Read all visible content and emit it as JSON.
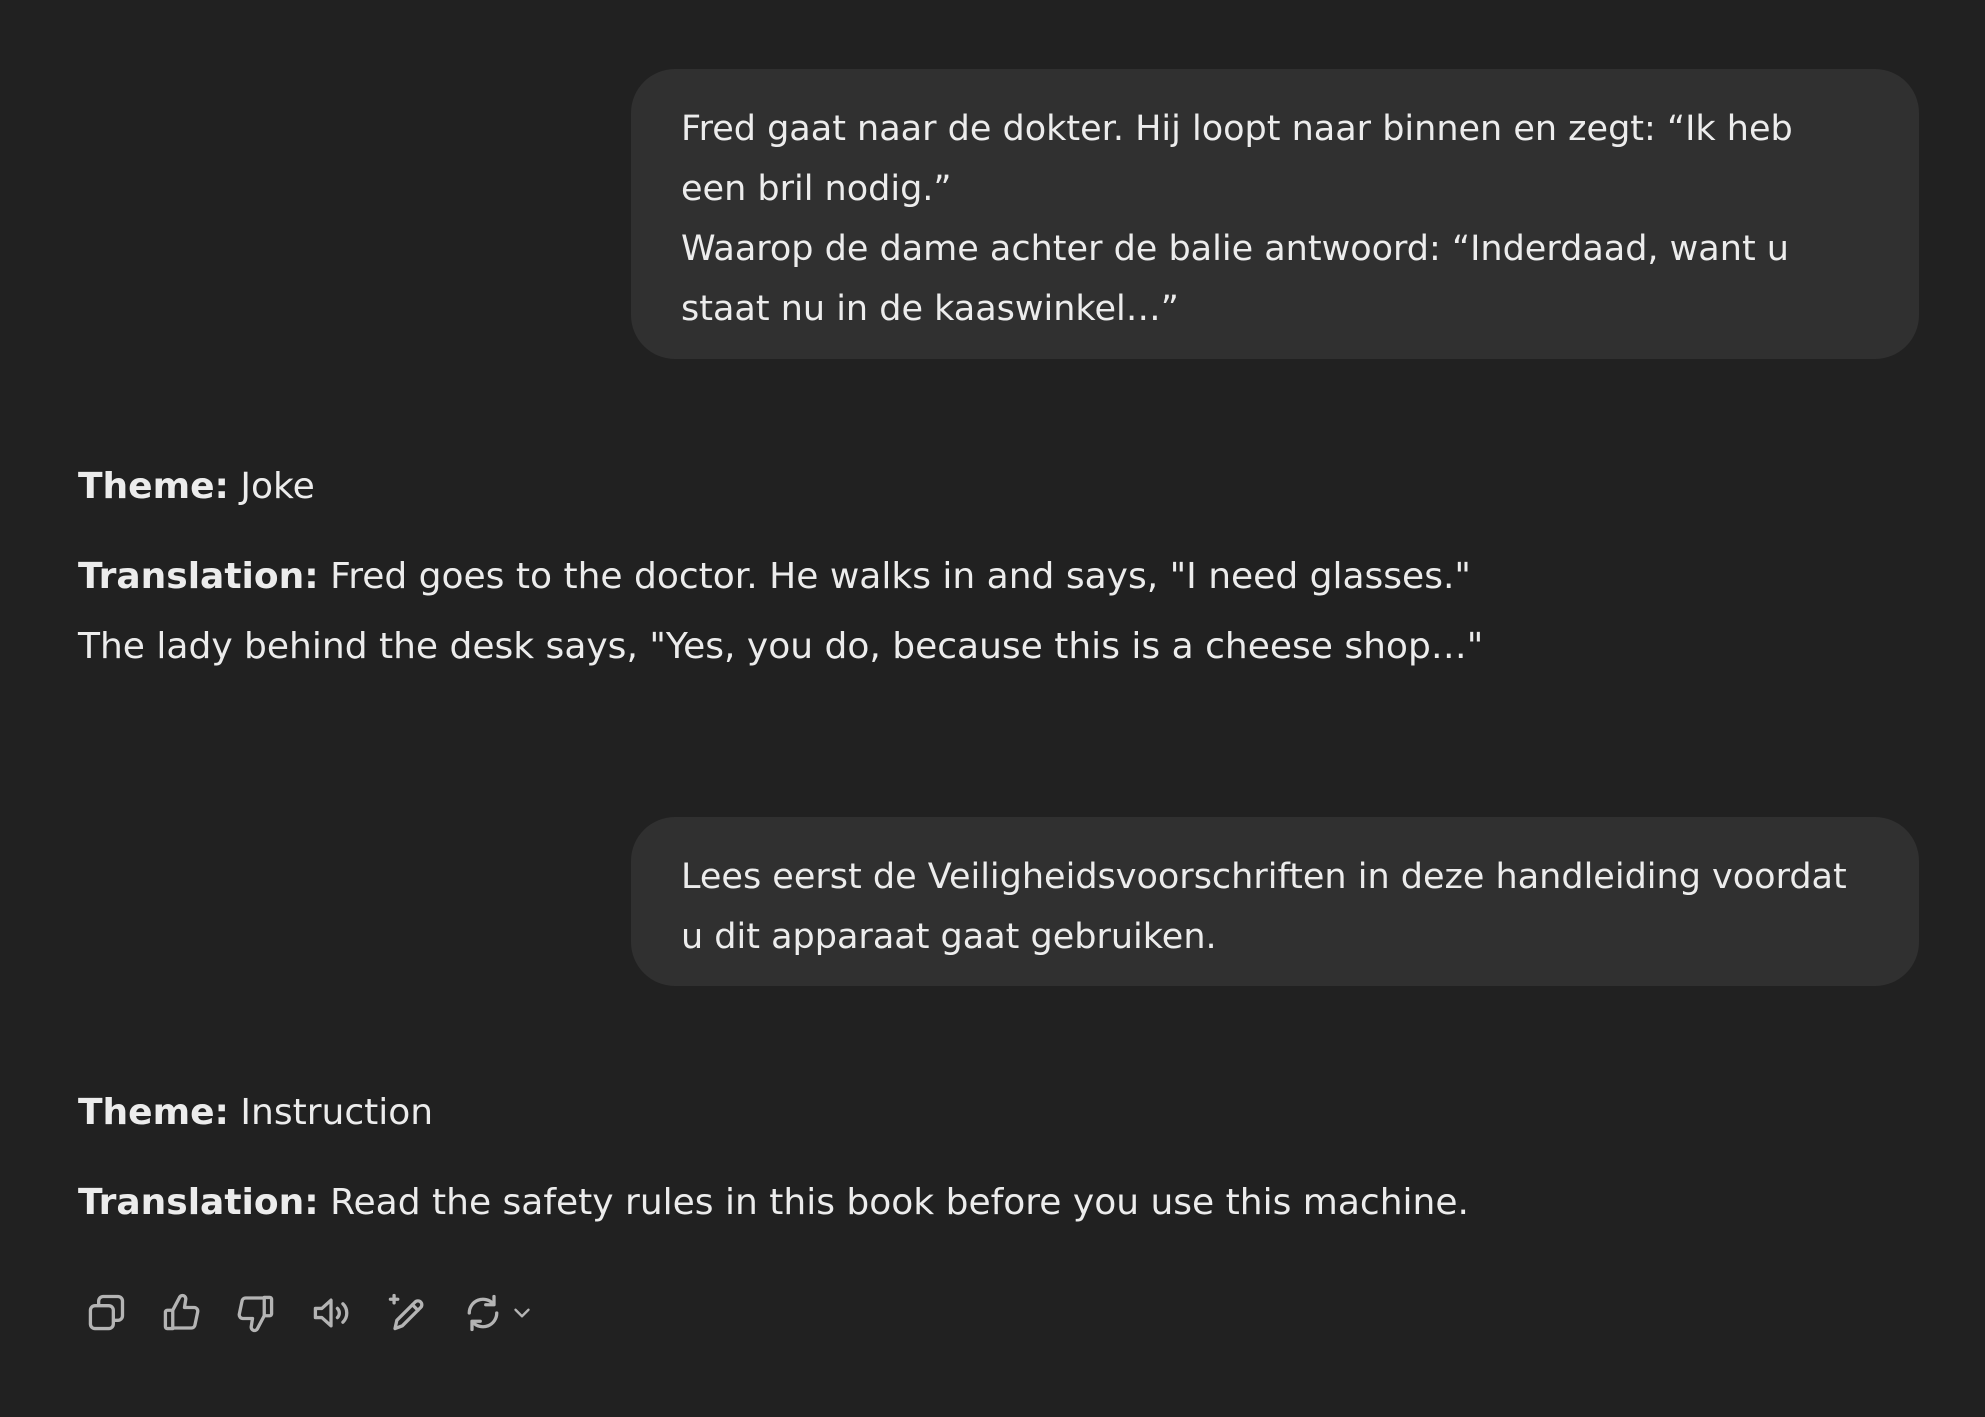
{
  "conversation": {
    "user_1": {
      "lines": [
        "Fred gaat naar de dokter. Hij loopt naar binnen en zegt: “Ik heb",
        "een bril nodig.”",
        "Waarop de dame achter de balie antwoord: “Inderdaad, want u",
        "staat nu in de kaaswinkel…”"
      ]
    },
    "assistant_1": {
      "theme_label": "Theme:",
      "theme_value": "Joke",
      "translation_label": "Translation:",
      "translation_line1": "Fred goes to the doctor. He walks in and says, \"I need glasses.\"",
      "translation_line2": "The lady behind the desk says, \"Yes, you do, because this is a cheese shop…\""
    },
    "user_2": {
      "lines": [
        "Lees eerst de Veiligheidsvoorschriften in deze handleiding voordat",
        "u dit apparaat gaat gebruiken."
      ]
    },
    "assistant_2": {
      "theme_label": "Theme:",
      "theme_value": "Instruction",
      "translation_label": "Translation:",
      "translation_line1": "Read the safety rules in this book before you use this machine."
    }
  },
  "actions": {
    "icons": [
      "copy-icon",
      "thumbs-up-icon",
      "thumbs-down-icon",
      "speaker-icon",
      "edit-sparkle-icon",
      "regenerate-icon",
      "chevron-down-icon"
    ]
  },
  "colors": {
    "background": "#212121",
    "user_bubble": "#303030",
    "text": "#ececec",
    "icon": "#b4b4b4"
  }
}
